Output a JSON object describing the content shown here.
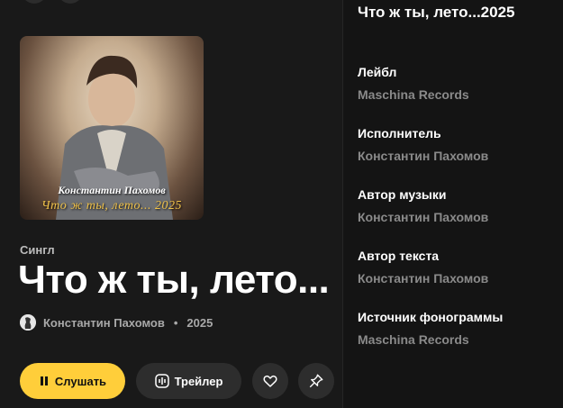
{
  "release": {
    "cover": {
      "artist_caption": "Константин Пахомов",
      "title_caption": "Что ж ты, лето... 2025"
    },
    "type": "Сингл",
    "title": "Что ж ты, лето...",
    "artist": "Константин Пахомов",
    "year": "2025"
  },
  "actions": {
    "play_label": "Слушать",
    "trailer_label": "Трейлер"
  },
  "panel": {
    "title": "Что ж ты, лето...2025",
    "fields": [
      {
        "label": "Лейбл",
        "value": "Maschina Records"
      },
      {
        "label": "Исполнитель",
        "value": "Константин Пахомов"
      },
      {
        "label": "Автор музыки",
        "value": "Константин Пахомов"
      },
      {
        "label": "Автор текста",
        "value": "Константин Пахомов"
      },
      {
        "label": "Источник фонограммы",
        "value": "Maschina Records"
      }
    ]
  },
  "colors": {
    "accent": "#ffce3a",
    "background": "#1a1a1a",
    "panel": "#141414"
  },
  "icons": [
    "back-icon",
    "more-icon",
    "pause-icon",
    "trailer-icon",
    "heart-icon",
    "pin-icon"
  ]
}
